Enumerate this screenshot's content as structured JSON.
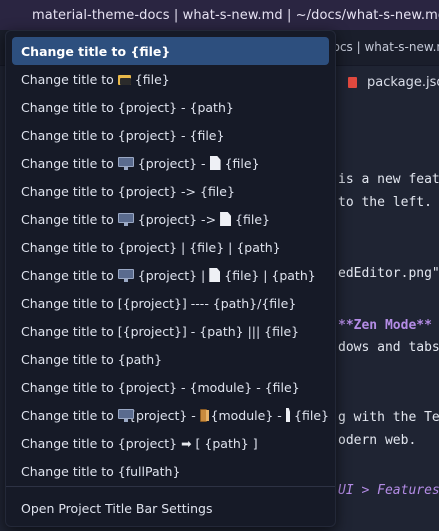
{
  "window": {
    "title": "material-theme-docs | what-s-new.md | ~/docs/what-s-new.md"
  },
  "background": {
    "tab_path": "docs | what-s-new.m",
    "tab_package": "package.jso",
    "code_lines": [
      "is a new feat",
      " to the left.",
      "edEditor.png\"",
      "**Zen Mode**",
      "dows and tabs",
      "g with the Te",
      "odern web.",
      "UI > Features"
    ]
  },
  "quickpick": {
    "items": [
      {
        "label": "Change title to {file}"
      },
      {
        "label_a": "Change title to",
        "label_b": "{file}"
      },
      {
        "label": "Change title to {project} - {path}"
      },
      {
        "label": "Change title to {project} - {file}"
      },
      {
        "label_a": "Change title to",
        "label_b": "{project} -",
        "label_c": "{file}"
      },
      {
        "label": "Change title to {project} -> {file}"
      },
      {
        "label_a": "Change title to",
        "label_b": "{project} ->",
        "label_c": "{file}"
      },
      {
        "label": "Change title to {project} | {file} | {path}"
      },
      {
        "label_a": "Change title to",
        "label_b": "{project} |",
        "label_c": "{file} | {path}"
      },
      {
        "label": "Change title to [{project}] ---- {path}/{file}"
      },
      {
        "label": "Change title to [{project}] - {path} ||| {file}"
      },
      {
        "label": "Change title to {path}"
      },
      {
        "label": "Change title to {project} - {module} - {file}"
      },
      {
        "label_a": "Change title to",
        "label_b": "{project} -",
        "label_c": "{module} -",
        "label_d": "{file}"
      },
      {
        "label_a": "Change title to {project}",
        "label_b": "[ {path} ]"
      },
      {
        "label": "Change title to {fullPath}"
      }
    ],
    "settings_label": "Open Project Title Bar Settings"
  },
  "colors": {
    "selected_bg": "#2d4f7e",
    "panel_bg": "#161a27",
    "titlebar_bg": "#2a2541",
    "accent": "#b48ce6"
  }
}
